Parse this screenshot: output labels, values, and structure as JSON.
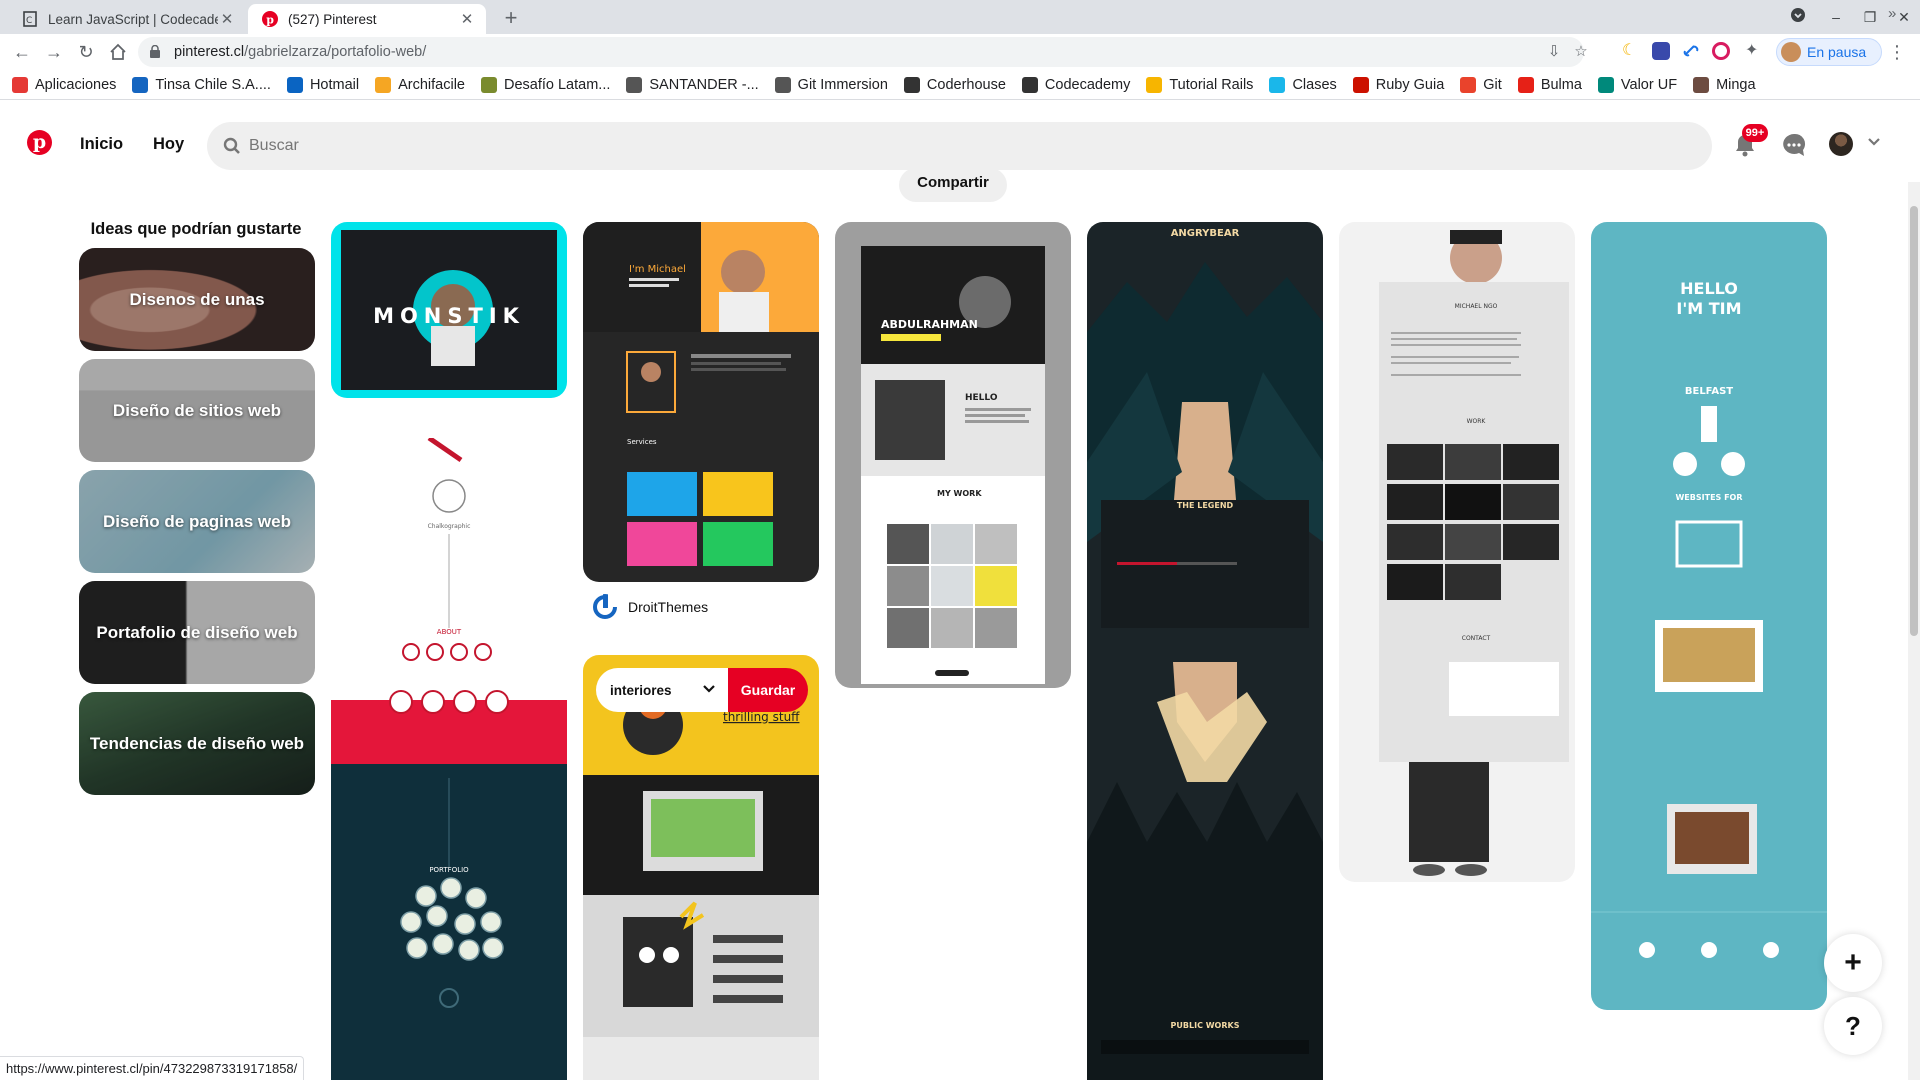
{
  "browser": {
    "tabs": [
      {
        "title": "Learn JavaScript | Codecademy",
        "favicon": "codecademy-icon",
        "active": false
      },
      {
        "title": "(527) Pinterest",
        "favicon": "pinterest-icon",
        "active": true
      }
    ],
    "url_host": "pinterest.cl",
    "url_path": "/gabrielzarza/portafolio-web/",
    "profile_label": "En pausa",
    "bookmarks": [
      {
        "label": "Aplicaciones",
        "icon": "apps-grid-icon",
        "color": "#e53935"
      },
      {
        "label": "Tinsa Chile S.A....",
        "icon": "tinsa-icon",
        "color": "#1565c0"
      },
      {
        "label": "Hotmail",
        "icon": "outlook-icon",
        "color": "#0a64c2"
      },
      {
        "label": "Archifacile",
        "icon": "home-icon",
        "color": "#f5a623"
      },
      {
        "label": "Desafío Latam...",
        "icon": "desafio-icon",
        "color": "#7a8b2e"
      },
      {
        "label": "SANTANDER -...",
        "icon": "globe-icon",
        "color": "#555555"
      },
      {
        "label": "Git Immersion",
        "icon": "globe-icon",
        "color": "#555555"
      },
      {
        "label": "Coderhouse",
        "icon": "coderhouse-icon",
        "color": "#333333"
      },
      {
        "label": "Codecademy",
        "icon": "codecademy-icon",
        "color": "#333333"
      },
      {
        "label": "Tutorial Rails",
        "icon": "rails-icon",
        "color": "#f7b500"
      },
      {
        "label": "Clases",
        "icon": "vimeo-icon",
        "color": "#1ab7ea"
      },
      {
        "label": "Ruby Guia",
        "icon": "ruby-icon",
        "color": "#cc1100"
      },
      {
        "label": "Git",
        "icon": "git-icon",
        "color": "#e9432c"
      },
      {
        "label": "Bulma",
        "icon": "youtube-icon",
        "color": "#e62117"
      },
      {
        "label": "Valor UF",
        "icon": "valoruf-icon",
        "color": "#00897b"
      },
      {
        "label": "Minga",
        "icon": "minga-icon",
        "color": "#6d4c41"
      }
    ],
    "status_url": "https://www.pinterest.cl/pin/473229873319171858/"
  },
  "pinterest": {
    "nav": {
      "home": "Inicio",
      "today": "Hoy"
    },
    "search_placeholder": "Buscar",
    "notifications_badge": "99+",
    "share_button": "Compartir",
    "accent": "#e60023"
  },
  "ideas": {
    "title": "Ideas que podrían gustarte",
    "items": [
      {
        "label": "Disenos de unas"
      },
      {
        "label": "Diseño de sitios web"
      },
      {
        "label": "Diseño de paginas web"
      },
      {
        "label": "Portafolio de diseño web"
      },
      {
        "label": "Tendencias de diseño web"
      }
    ]
  },
  "pins": {
    "droit_name": "DroitThemes",
    "board_select": "interiores",
    "save_label": "Guardar",
    "monstik_text": "MONSTIK",
    "michael_title": "I'm Michael",
    "michael_services": "Services",
    "abdul_name": "ABDULRAHMAN",
    "abdul_hello": "HELLO",
    "abdul_work": "MY WORK",
    "angrybear_title": "ANGRYBEAR",
    "angrybear_legend": "THE LEGEND",
    "angrybear_public": "PUBLIC WORKS",
    "michael_ngo": "MICHAEL NGO",
    "ngo_work": "WORK",
    "ngo_contact": "CONTACT",
    "tim_hello": "HELLO",
    "tim_im": "I'M TIM",
    "tim_belfast": "BELFAST",
    "tim_websites": "WEBSITES FOR",
    "chalk_about": "ABOUT",
    "chalk_portfolio": "PORTFOLIO",
    "thrilling": "thrilling stuff"
  }
}
